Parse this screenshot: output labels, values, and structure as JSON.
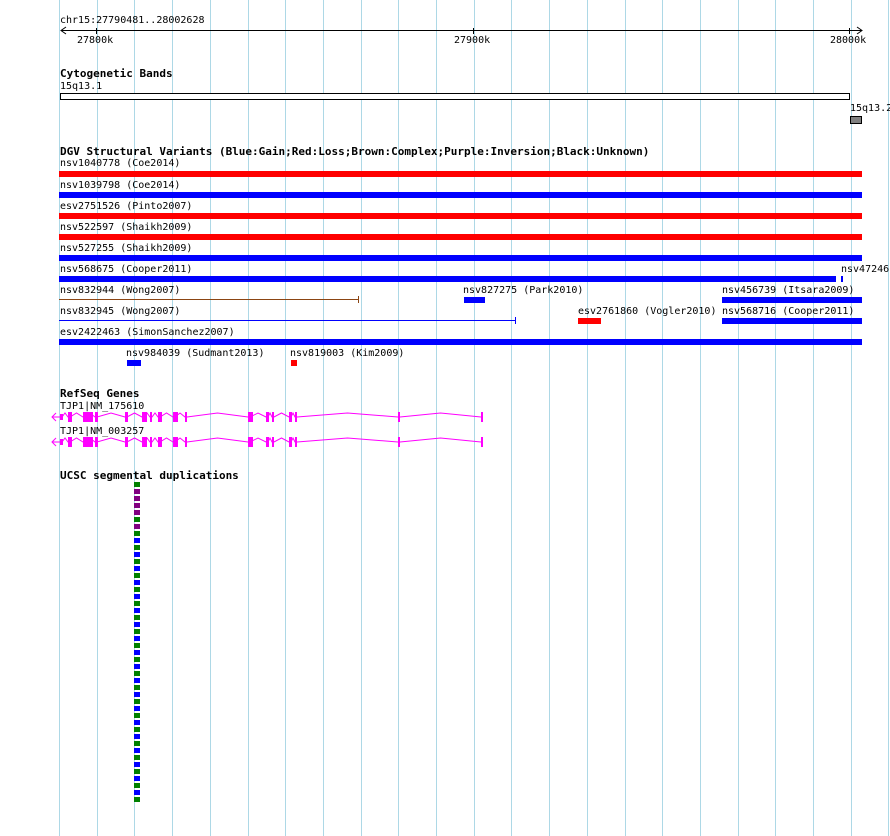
{
  "colors": {
    "gridline": "#add8e6",
    "gain": "#0000ff",
    "loss": "#ff0000",
    "complex": "#8b4513",
    "gene": "#ff00ff",
    "segdup_green": "#008000",
    "segdup_blue": "#0000ff",
    "segdup_purple": "#800080"
  },
  "ruler": {
    "region": "chr15:27790481..28002628",
    "ticks": [
      "27800k",
      "27900k",
      "28000k"
    ]
  },
  "cytoband": {
    "title": "Cytogenetic Bands",
    "band1": "15q13.1",
    "band2": "15q13.2"
  },
  "dgv": {
    "title": "DGV Structural Variants (Blue:Gain;Red:Loss;Brown:Complex;Purple:Inversion;Black:Unknown)",
    "labels": {
      "nsv1040778": "nsv1040778 (Coe2014)",
      "nsv1039798": "nsv1039798 (Coe2014)",
      "esv2751526": "esv2751526 (Pinto2007)",
      "nsv522597": "nsv522597 (Shaikh2009)",
      "nsv527255": "nsv527255 (Shaikh2009)",
      "nsv568675": "nsv568675 (Cooper2011)",
      "nsv47246": "nsv47246",
      "nsv832944": "nsv832944 (Wong2007)",
      "nsv827275": "nsv827275 (Park2010)",
      "nsv456739": "nsv456739 (Itsara2009)",
      "nsv832945": "nsv832945 (Wong2007)",
      "esv2761860": "esv2761860 (Vogler2010)",
      "nsv568716": "nsv568716 (Cooper2011)",
      "esv2422463": "esv2422463 (SimonSanchez2007)",
      "nsv984039": "nsv984039 (Sudmant2013)",
      "nsv819003": "nsv819003 (Kim2009)"
    }
  },
  "refseq": {
    "title": "RefSeq Genes",
    "transcript1": "TJP1|NM_175610",
    "transcript2": "TJP1|NM_003257"
  },
  "segdup": {
    "title": "UCSC segmental duplications"
  }
}
